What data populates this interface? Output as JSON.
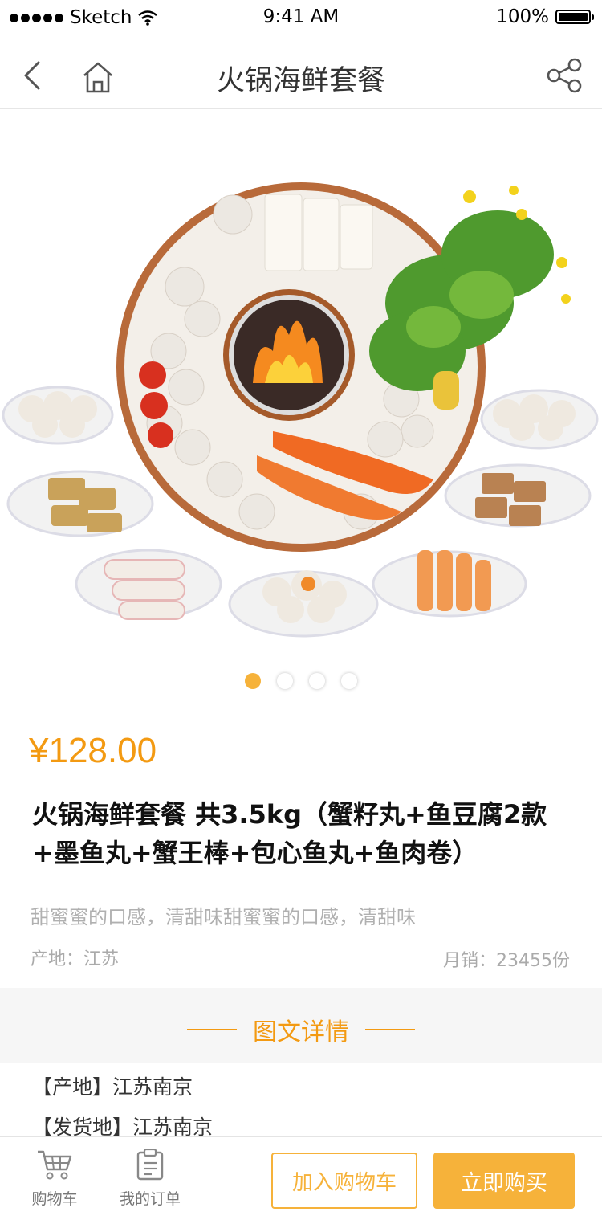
{
  "status_bar": {
    "carrier": "Sketch",
    "time": "9:41 AM",
    "battery": "100%"
  },
  "nav": {
    "title": "火锅海鲜套餐",
    "icons": [
      "back-icon",
      "home-icon",
      "share-icon"
    ]
  },
  "carousel": {
    "count": 4,
    "active_index": 0
  },
  "product": {
    "price": "¥128.00",
    "title": "火锅海鲜套餐 共3.5kg（蟹籽丸+鱼豆腐2款+墨鱼丸+蟹王棒+包心鱼丸+鱼肉卷）",
    "description": "甜蜜蜜的口感，清甜味甜蜜蜜的口感，清甜味",
    "origin": "产地：江苏",
    "monthly_sales": "月销：23455份"
  },
  "details": {
    "heading": "图文详情",
    "lines": [
      "【产地】江苏南京",
      "【发货地】江苏南京"
    ]
  },
  "bottom_bar": {
    "cart_label": "购物车",
    "orders_label": "我的订单",
    "add_to_cart": "加入购物车",
    "buy_now": "立即购买"
  },
  "colors": {
    "accent": "#f39a12",
    "button": "#f6b23a"
  }
}
